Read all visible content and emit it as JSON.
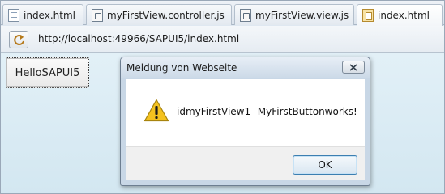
{
  "browser": {
    "tabs": [
      {
        "label": "index.html",
        "icon": "page-icon",
        "active": false
      },
      {
        "label": "myFirstView.controller.js",
        "icon": "js-file-icon",
        "active": false
      },
      {
        "label": "myFirstView.view.js",
        "icon": "js-file-icon",
        "active": false
      },
      {
        "label": "index.html",
        "icon": "html-file-icon",
        "active": true
      }
    ],
    "address": {
      "url": "http://localhost:49966/SAPUI5/index.html",
      "nav_icon": "refresh-icon"
    }
  },
  "page": {
    "button_label": "HelloSAPUI5"
  },
  "dialog": {
    "title": "Meldung von Webseite",
    "message": "idmyFirstView1--MyFirstButtonworks!",
    "icon": "warning-icon",
    "ok_label": "OK"
  },
  "colors": {
    "page_background": "#d3e7f1",
    "dialog_frame": "#c8d7e6",
    "warning": "#f4c21f"
  }
}
